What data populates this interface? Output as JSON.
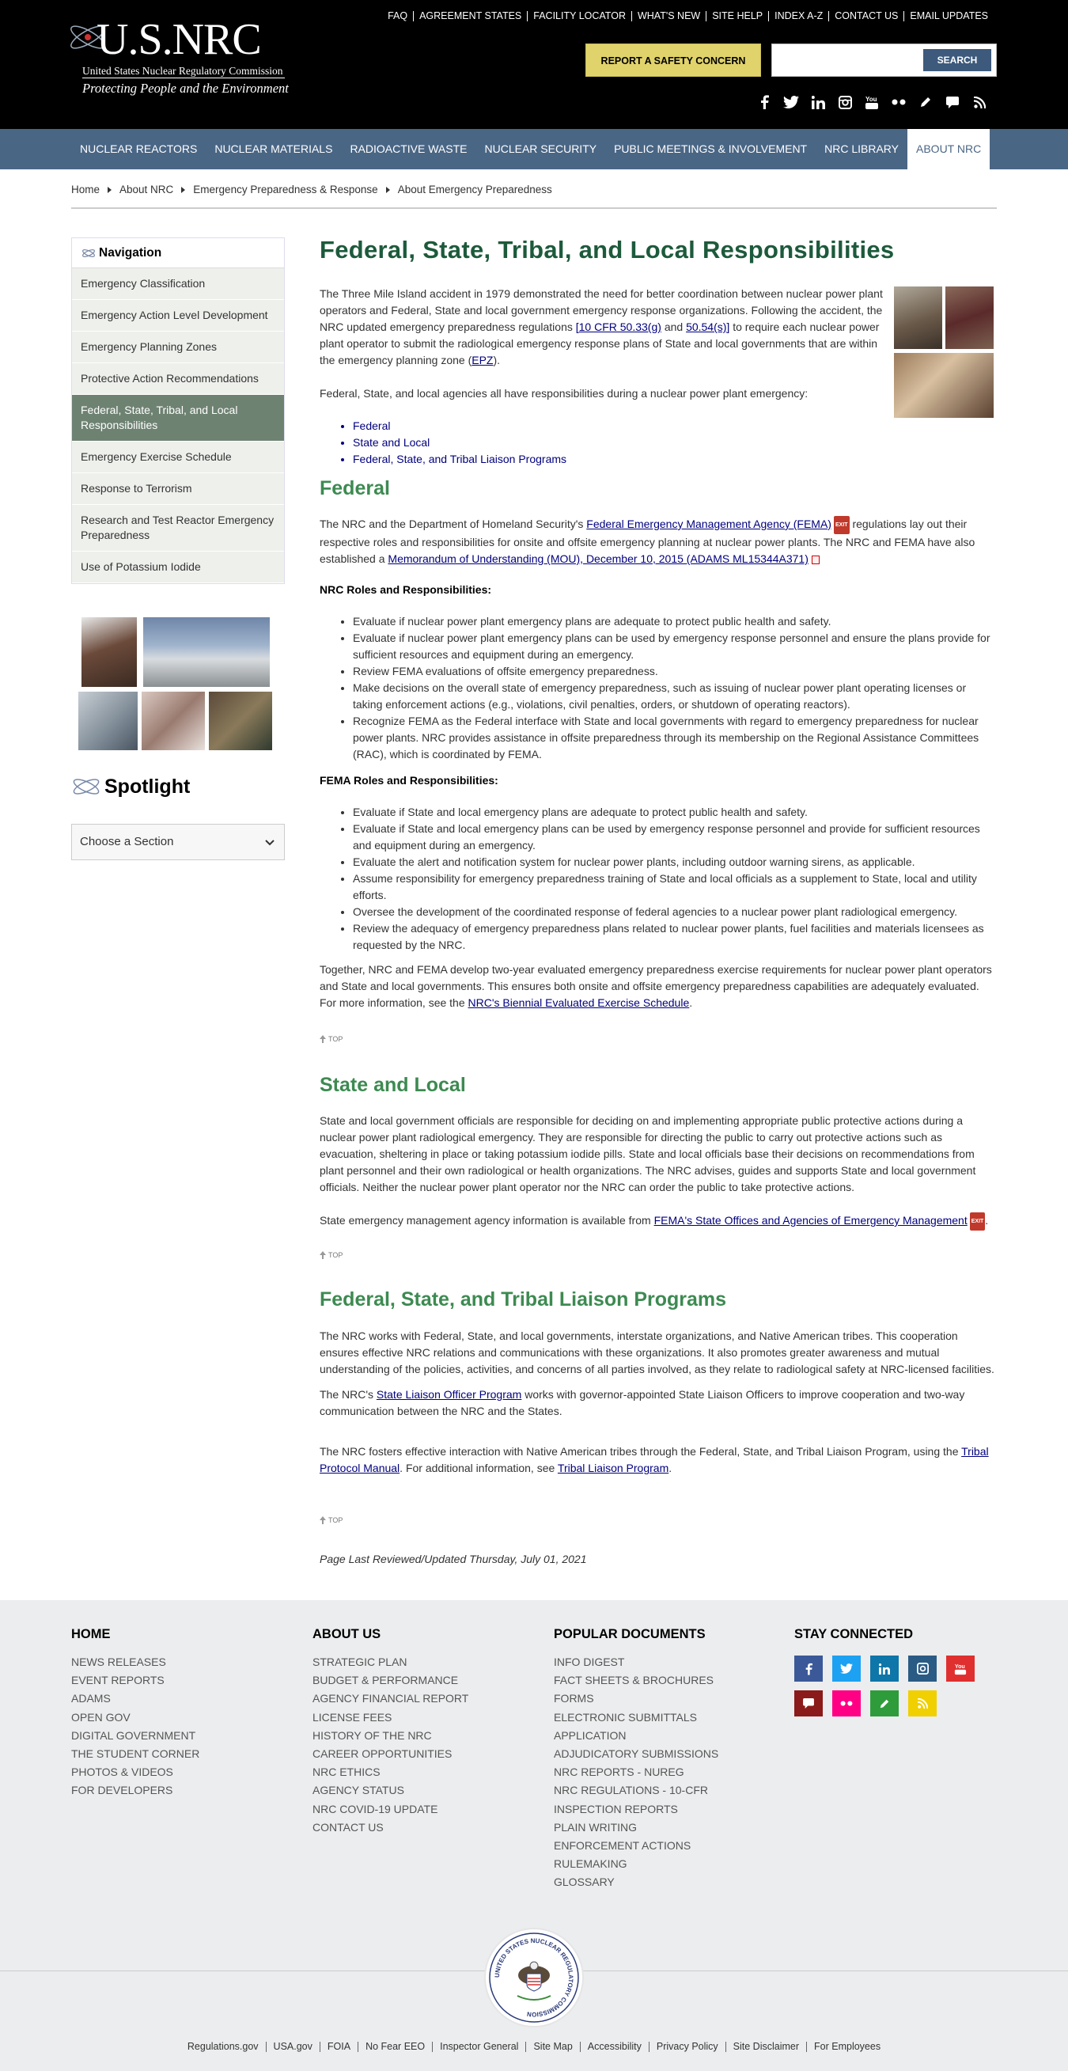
{
  "header": {
    "logo_main": "U.S.NRC",
    "logo_sub": "United States Nuclear Regulatory Commission",
    "logo_tagline": "Protecting People and the Environment",
    "utility_links": [
      "FAQ",
      "AGREEMENT STATES",
      "FACILITY LOCATOR",
      "WHAT'S NEW",
      "SITE HELP",
      "INDEX A-Z",
      "CONTACT US",
      "EMAIL UPDATES"
    ],
    "report_button": "REPORT A SAFETY CONCERN",
    "search_placeholder": "",
    "search_button": "SEARCH",
    "social_icons": [
      "facebook-icon",
      "twitter-icon",
      "linkedin-icon",
      "instagram-icon",
      "youtube-icon",
      "flickr-icon",
      "pen-icon",
      "chat-icon",
      "rss-icon"
    ]
  },
  "main_nav": [
    "NUCLEAR REACTORS",
    "NUCLEAR MATERIALS",
    "RADIOACTIVE WASTE",
    "NUCLEAR SECURITY",
    "PUBLIC MEETINGS & INVOLVEMENT",
    "NRC LIBRARY",
    "ABOUT NRC"
  ],
  "breadcrumb": [
    "Home",
    "About NRC",
    "Emergency Preparedness & Response",
    "About Emergency Preparedness"
  ],
  "sidebar": {
    "title": "Navigation",
    "items": [
      "Emergency Classification",
      "Emergency Action Level Development",
      "Emergency Planning Zones",
      "Protective Action Recommendations",
      "Federal, State, Tribal, and Local Responsibilities",
      "Emergency Exercise Schedule",
      "Response to Terrorism",
      "Research and Test Reactor Emergency Preparedness",
      "Use of Potassium Iodide"
    ],
    "spotlight_title": "Spotlight",
    "spotlight_select": "Choose a Section"
  },
  "content": {
    "title": "Federal, State, Tribal, and Local Responsibilities",
    "intro_1": "The Three Mile Island accident in 1979 demonstrated the need for better coordination between nuclear power plant operators and Federal, State and local government emergency response organizations. Following the accident, the NRC updated emergency preparedness regulations",
    "intro_link_1": "[10 CFR 50.33(g)",
    "intro_and": "and",
    "intro_link_2": "50.54(s)]",
    "intro_2": "to require each nuclear power plant operator to submit the radiological emergency response plans of State and local governments that are within the emergency planning zone (",
    "intro_epz": "EPZ",
    "intro_3": ").",
    "agencies_line": "Federal, State, and local agencies all have responsibilities during a nuclear power plant emergency:",
    "toc": [
      "Federal",
      "State and Local",
      "Federal, State, and Tribal Liaison Programs"
    ],
    "federal_heading": "Federal",
    "federal_p1_a": "The NRC and the Department of Homeland Security's",
    "federal_fema_link": "Federal Emergency Management Agency (FEMA)",
    "federal_p1_b": "regulations lay out their respective roles and responsibilities for onsite and offsite emergency planning at nuclear power plants. The NRC and FEMA have also established a",
    "federal_mou_link": "Memorandum of Understanding (MOU), December 10, 2015 (ADAMS ML15344A371)",
    "exit_label": "EXIT",
    "nrc_roles_heading": "NRC Roles and Responsibilities:",
    "nrc_roles": [
      "Evaluate if nuclear power plant emergency plans are adequate to protect public health and safety.",
      "Evaluate if nuclear power plant emergency plans can be used by emergency response personnel and ensure the plans provide for sufficient resources and equipment during an emergency.",
      "Review FEMA evaluations of offsite emergency preparedness.",
      "Make decisions on the overall state of emergency preparedness, such as issuing of nuclear power plant operating licenses or taking enforcement actions (e.g., violations, civil penalties, orders, or shutdown of operating reactors).",
      "Recognize FEMA as the Federal interface with State and local governments with regard to emergency preparedness for nuclear power plants. NRC provides assistance in offsite preparedness through its membership on the Regional Assistance Committees (RAC), which is coordinated by FEMA."
    ],
    "fema_roles_heading": "FEMA Roles and Responsibilities:",
    "fema_roles": [
      "Evaluate if State and local emergency plans are adequate to protect public health and safety.",
      "Evaluate if State and local emergency plans can be used by emergency response personnel and provide for sufficient resources and equipment during an emergency.",
      "Evaluate the alert and notification system for nuclear power plants, including outdoor warning sirens, as applicable.",
      "Assume responsibility for emergency preparedness training of State and local officials as a supplement to State, local and utility efforts.",
      "Oversee the development of the coordinated response of federal agencies to a nuclear power plant radiological emergency.",
      "Review the adequacy of emergency preparedness plans related to nuclear power plants, fuel facilities and materials licensees as requested by the NRC."
    ],
    "together_p": "Together, NRC and FEMA develop two-year evaluated emergency preparedness exercise requirements for nuclear power plant operators and State and local governments. This ensures both onsite and offsite emergency preparedness capabilities are adequately evaluated. For more information, see the",
    "together_link": "NRC's Biennial Evaluated Exercise Schedule",
    "top_label": "TOP",
    "state_heading": "State and Local",
    "state_p1": "State and local government officials are responsible for deciding on and implementing appropriate public protective actions during a nuclear power plant radiological emergency. They are responsible for directing the public to carry out protective actions such as evacuation, sheltering in place or taking potassium iodide pills. State and local officials base their decisions on recommendations from plant personnel and their own radiological or health organizations. The NRC advises, guides and supports State and local government officials. Neither the nuclear power plant operator nor the NRC can order the public to take protective actions.",
    "state_p2": "State emergency management agency information is available from",
    "state_link": "FEMA's State Offices and Agencies of Emergency Management",
    "liaison_heading": "Federal, State, and Tribal Liaison Programs",
    "liaison_p1": "The NRC works with Federal, State, and local governments, interstate organizations, and Native American tribes. This cooperation ensures effective NRC relations and communications with these organizations. It also promotes greater awareness and mutual understanding of the policies, activities, and concerns of all parties involved, as they relate to radiological safety at NRC-licensed facilities.",
    "liaison_p2_a": "The NRC's",
    "liaison_p2_link": "State Liaison Officer Program",
    "liaison_p2_b": "works with governor-appointed State Liaison Officers to improve cooperation and two-way communication between the NRC and the States.",
    "liaison_p3_a": "The NRC fosters effective interaction with Native American tribes through the Federal, State, and Tribal Liaison Program, using the",
    "liaison_p3_link1": "Tribal Protocol Manual",
    "liaison_p3_b": ". For additional information, see",
    "liaison_p3_link2": "Tribal Liaison Program",
    "last_reviewed": "Page Last Reviewed/Updated Thursday, July 01, 2021"
  },
  "footer": {
    "col1": {
      "head": "HOME",
      "links": [
        "NEWS RELEASES",
        "EVENT REPORTS",
        "ADAMS",
        "OPEN GOV",
        "DIGITAL GOVERNMENT",
        "THE STUDENT CORNER",
        "PHOTOS & VIDEOS",
        "FOR DEVELOPERS"
      ]
    },
    "col2": {
      "head": "ABOUT US",
      "links": [
        "STRATEGIC PLAN",
        "BUDGET & PERFORMANCE",
        "AGENCY FINANCIAL REPORT",
        "LICENSE FEES",
        "HISTORY OF THE NRC",
        "CAREER OPPORTUNITIES",
        "NRC ETHICS",
        "AGENCY STATUS",
        "NRC COVID-19 UPDATE",
        "CONTACT US"
      ]
    },
    "col3": {
      "head": "POPULAR DOCUMENTS",
      "links": [
        "INFO DIGEST",
        "FACT SHEETS & BROCHURES",
        "FORMS",
        "ELECTRONIC SUBMITTALS",
        "APPLICATION",
        "ADJUDICATORY SUBMISSIONS",
        "NRC REPORTS - NUREG",
        "NRC REGULATIONS - 10-CFR",
        "INSPECTION REPORTS",
        "PLAIN WRITING",
        "ENFORCEMENT ACTIONS",
        "RULEMAKING",
        "GLOSSARY"
      ]
    },
    "col4": {
      "head": "STAY CONNECTED"
    },
    "social_colors": [
      "#3b5998",
      "#1da1f2",
      "#0e76a8",
      "#2a5b84",
      "#e02f2f",
      "#8b1a1a",
      "#ff0084",
      "#2e9c3a",
      "#f0d000"
    ],
    "seal_text": "UNITED STATES NUCLEAR REGULATORY COMMISSION",
    "bottom_links": [
      "Regulations.gov",
      "USA.gov",
      "FOIA",
      "No Fear EEO",
      "Inspector General",
      "Site Map",
      "Accessibility",
      "Privacy Policy",
      "Site Disclaimer",
      "For Employees"
    ]
  }
}
